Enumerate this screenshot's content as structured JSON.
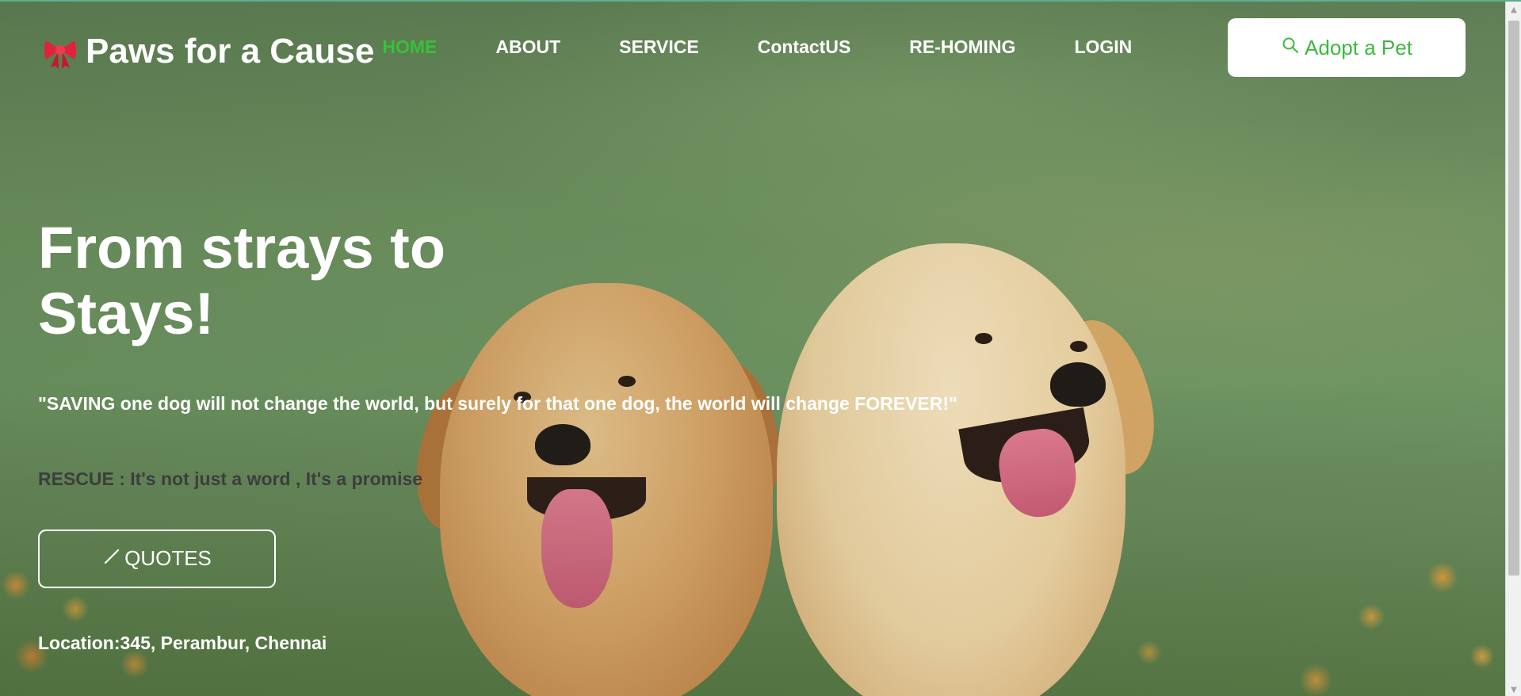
{
  "brand": {
    "name": "Paws for a Cause",
    "icon": "bow-icon",
    "icon_color": "#e2223a"
  },
  "nav": {
    "items": [
      {
        "label": "HOME",
        "active": true
      },
      {
        "label": "ABOUT",
        "active": false
      },
      {
        "label": "SERVICE",
        "active": false
      },
      {
        "label": "ContactUS",
        "active": false
      },
      {
        "label": "RE-HOMING",
        "active": false
      },
      {
        "label": "LOGIN",
        "active": false
      }
    ],
    "active_color": "#38c13b"
  },
  "header": {
    "adopt_button": {
      "label": "Adopt a Pet",
      "icon": "search-icon",
      "color": "#3bb83d"
    }
  },
  "hero": {
    "title_line1": "From strays to",
    "title_line2": "Stays!",
    "quote": "\"SAVING one dog will not change the world, but surely for that one dog, the world will change FOREVER!\"",
    "tagline": "RESCUE : It's not just a word , It's a promise",
    "quotes_button": {
      "label": "QUOTES",
      "icon": "pencil-icon"
    },
    "location": "Location:345, Perambur, Chennai"
  }
}
